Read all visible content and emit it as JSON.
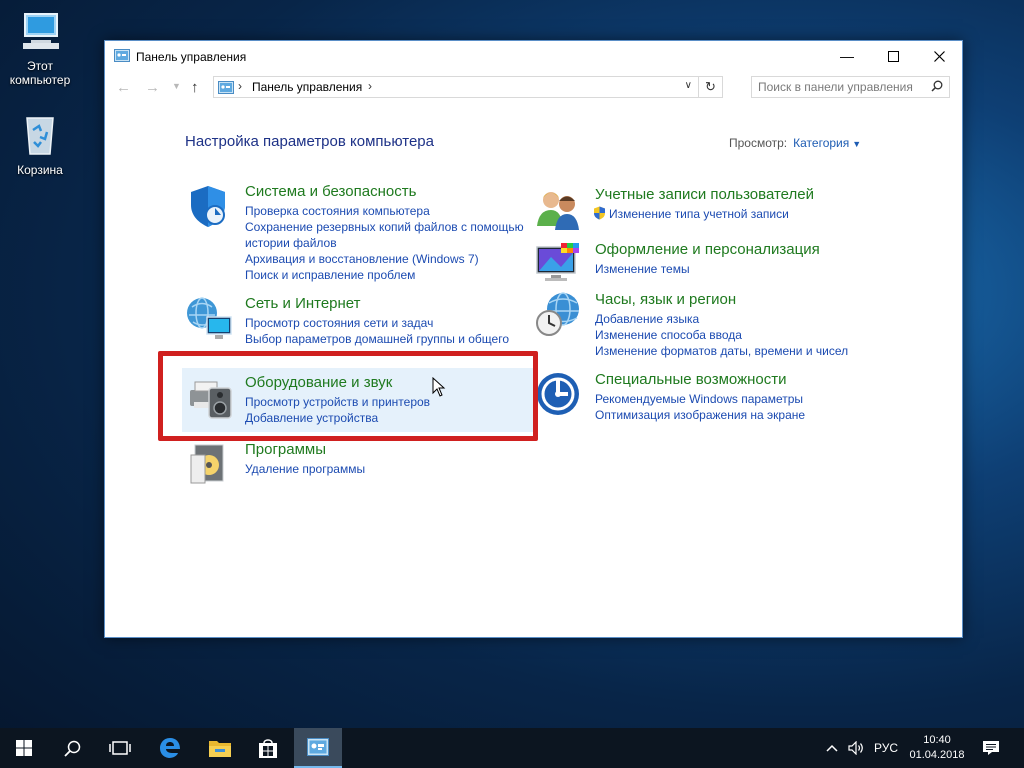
{
  "desktop": {
    "icons": [
      {
        "label": "Этот компьютер",
        "icon": "this-pc-icon"
      },
      {
        "label": "Корзина",
        "icon": "recycle-bin-icon"
      }
    ]
  },
  "window": {
    "title": "Панель управления",
    "address": {
      "crumb": "Панель управления",
      "separator": "›"
    },
    "search_placeholder": "Поиск в панели управления"
  },
  "content": {
    "heading": "Настройка параметров компьютера",
    "view_label": "Просмотр:",
    "view_value": "Категория",
    "categories_left": [
      {
        "title": "Система и безопасность",
        "icon": "security-shield-icon",
        "links": [
          "Проверка состояния компьютера",
          "Сохранение резервных копий файлов с помощью истории файлов",
          "Архивация и восстановление (Windows 7)",
          "Поиск и исправление проблем"
        ]
      },
      {
        "title": "Сеть и Интернет",
        "icon": "network-globe-icon",
        "links": [
          "Просмотр состояния сети и задач",
          "Выбор параметров домашней группы и общего"
        ]
      },
      {
        "title": "Оборудование и звук",
        "icon": "printer-speaker-icon",
        "links": [
          "Просмотр устройств и принтеров",
          "Добавление устройства"
        ]
      },
      {
        "title": "Программы",
        "icon": "programs-disk-icon",
        "links": [
          "Удаление программы"
        ]
      }
    ],
    "categories_right": [
      {
        "title": "Учетные записи пользователей",
        "icon": "users-icon",
        "links": [
          "Изменение типа учетной записи"
        ]
      },
      {
        "title": "Оформление и персонализация",
        "icon": "monitor-palette-icon",
        "links": [
          "Изменение темы"
        ]
      },
      {
        "title": "Часы, язык и регион",
        "icon": "clock-globe-icon",
        "links": [
          "Добавление языка",
          "Изменение способа ввода",
          "Изменение форматов даты, времени и чисел"
        ]
      },
      {
        "title": "Специальные возможности",
        "icon": "accessibility-icon",
        "links": [
          "Рекомендуемые Windows параметры",
          "Оптимизация изображения на экране"
        ]
      }
    ]
  },
  "taskbar": {
    "items": [
      "start-icon",
      "search-icon",
      "task-view-icon",
      "edge-icon",
      "explorer-icon",
      "store-icon",
      "control-panel-icon"
    ],
    "language": "РУС",
    "time": "10:40",
    "date": "01.04.2018"
  },
  "colors": {
    "category_title": "#1f7a1f",
    "link": "#1c4bb1",
    "heading": "#1e3287",
    "highlight": "#d0201f",
    "hover_bg": "#e5f1fb"
  }
}
